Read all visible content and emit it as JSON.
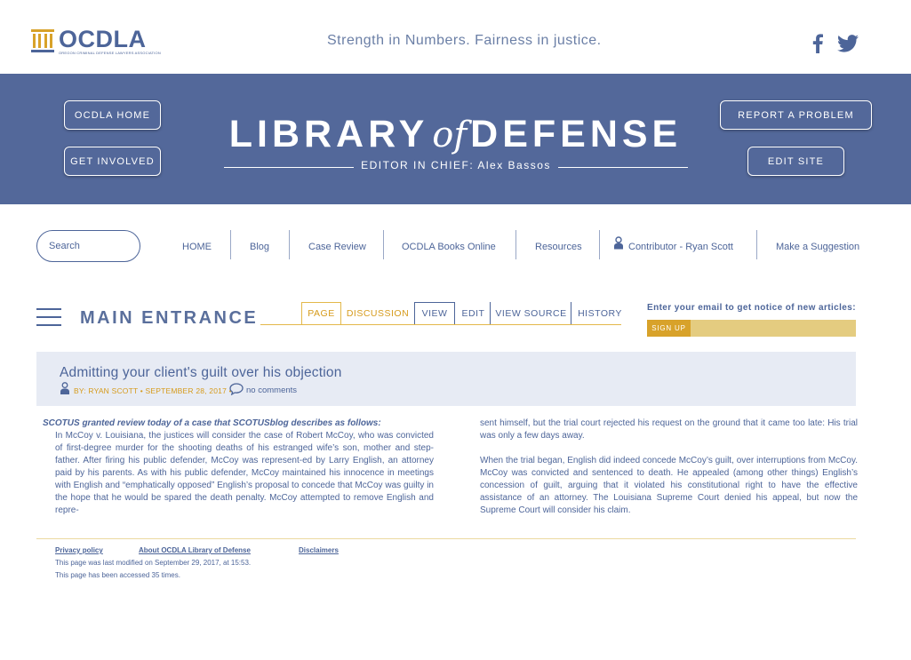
{
  "header": {
    "logo_text": "OCDLA",
    "logo_subtext": "OREGON CRIMINAL DEFENSE LAWYERS ASSOCIATION",
    "tagline": "Strength in Numbers. Fairness in justice."
  },
  "banner": {
    "home_button": "OCDLA HOME",
    "involved_button": "GET INVOLVED",
    "report_button": "REPORT A PROBLEM",
    "edit_site_button": "EDIT SITE",
    "title_left": "LIBRARY",
    "title_of": "of",
    "title_right": "DEFENSE",
    "editor_line": "EDITOR IN CHIEF: Alex Bassos"
  },
  "search": {
    "placeholder": "Search"
  },
  "nav": {
    "home": "HOME",
    "blog": "Blog",
    "case_review": "Case Review",
    "books": "OCDLA Books Online",
    "resources": "Resources",
    "contributor": "Contributor - Ryan Scott",
    "suggestion": "Make a Suggestion"
  },
  "page": {
    "section_title": "MAIN ENTRANCE",
    "tabs": {
      "page": "PAGE",
      "discussion": "DISCUSSION",
      "view": "VIEW",
      "edit": "EDIT",
      "view_source": "VIEW SOURCE",
      "history": "HISTORY"
    }
  },
  "subscribe": {
    "notice": "Enter your email to get notice of new articles:",
    "button": "SIGN UP"
  },
  "article": {
    "title": "Admitting your client's guilt over his objection",
    "byline": "BY: RYAN SCOTT • SEPTEMBER 28, 2017 •",
    "comments": "no comments",
    "lead": "SCOTUS granted review today of a case that SCOTUSblog describes as follows:",
    "col1_body": "In McCoy v. Louisiana, the justices will consider the case of Robert McCoy, who was convicted of first-degree murder for the shooting deaths of his estranged wife’s son, mother and step-father. After firing his public defender, McCoy was represent-ed by Larry English, an attorney paid by his parents. As with his public defender, McCoy maintained his innocence in meetings with English and “emphatically opposed” English’s proposal to concede that McCoy was guilty in the hope that he would be spared the death penalty. McCoy attempted to remove English and repre-",
    "col2_p1": "sent himself, but the trial court rejected his request on the ground that it came too late: His trial was only a few days away.",
    "col2_p2": "When the trial began, English did indeed concede McCoy’s guilt, over interruptions from McCoy. McCoy was convicted and sentenced to death. He appealed (among other things) English’s concession of guilt, arguing that it violated his constitutional right to have the effective assistance of an attorney. The Louisiana Supreme Court denied his appeal, but now the Supreme Court will consider his claim."
  },
  "footer": {
    "privacy": "Privacy policy",
    "about": "About OCDLA Library of Defense",
    "disclaimers": "Disclaimers",
    "modified": "This page was last modified on September 29, 2017, at 15:53.",
    "accessed": "This page has been accessed 35 times."
  },
  "colors": {
    "brand_blue": "#53689a",
    "text_blue": "#4d6599",
    "accent_gold": "#d69b1c",
    "signup_gold": "#d8a22a",
    "field_gold": "#e4cc80",
    "article_bg": "#e7ebf4"
  },
  "icons": [
    "ocdla-logo-icon",
    "facebook-icon",
    "twitter-icon",
    "user-icon",
    "hamburger-menu-icon",
    "comment-bubble-icon"
  ]
}
